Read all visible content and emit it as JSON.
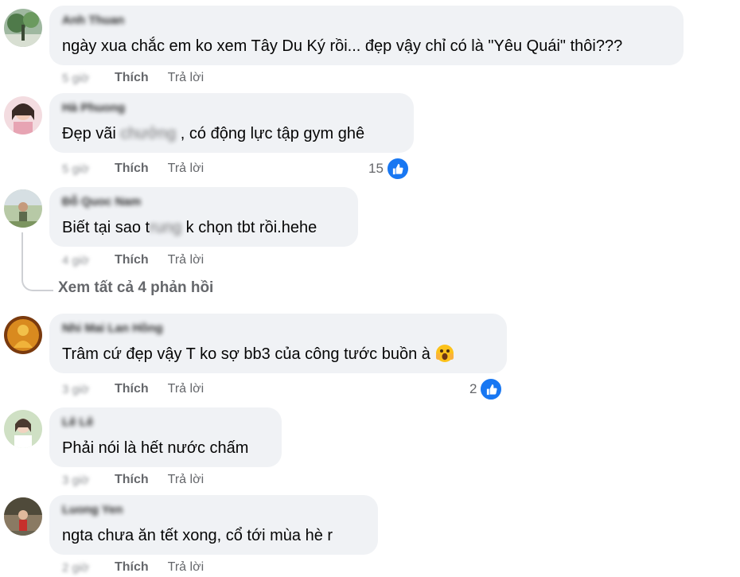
{
  "comments": [
    {
      "author": "Anh Thuan",
      "text": "ngày xua chắc em ko xem Tây Du Ký rồi... đẹp vậy chỉ có là \"Yêu Quái\" thôi???",
      "time": "5 giờ",
      "like_label": "Thích",
      "reply_label": "Trả lời",
      "reactions": null
    },
    {
      "author": "Hà Phuong",
      "text_before": "Đẹp vãi ",
      "text_hidden": "chưởng",
      "text_after": " , có động lực tập gym ghê",
      "time": "5 giờ",
      "like_label": "Thích",
      "reply_label": "Trả lời",
      "reactions": "15"
    },
    {
      "author": "Đỗ Quoc Nam",
      "text_before": "Biết tại sao t",
      "text_hidden": "rung",
      "text_after": " k chọn tbt rồi.hehe",
      "time": "4 giờ",
      "like_label": "Thích",
      "reply_label": "Trả lời",
      "reactions": null,
      "view_replies": "Xem tất cả 4 phản hồi"
    },
    {
      "author": "Nhi Mai Lan Hồng",
      "text": "Trâm cứ đẹp vậy T ko sợ bb3 của công tước buồn à",
      "time": "3 giờ",
      "like_label": "Thích",
      "reply_label": "Trả lời",
      "reactions": "2"
    },
    {
      "author": "Lê Lê",
      "text": "Phải nói là hết nước chấm",
      "time": "3 giờ",
      "like_label": "Thích",
      "reply_label": "Trả lời",
      "reactions": null
    },
    {
      "author": "Luong Yen",
      "text": "ngta chưa ăn tết xong, cổ tới mùa hè r",
      "time": "2 giờ",
      "like_label": "Thích",
      "reply_label": "Trả lời",
      "reactions": null
    }
  ],
  "colors": {
    "bubble": "#f0f2f5",
    "secondary_text": "#65676b",
    "like_blue": "#1877f2"
  },
  "icons": {
    "like": "thumbs-up-icon",
    "emoji": "face-screaming-emoji"
  }
}
